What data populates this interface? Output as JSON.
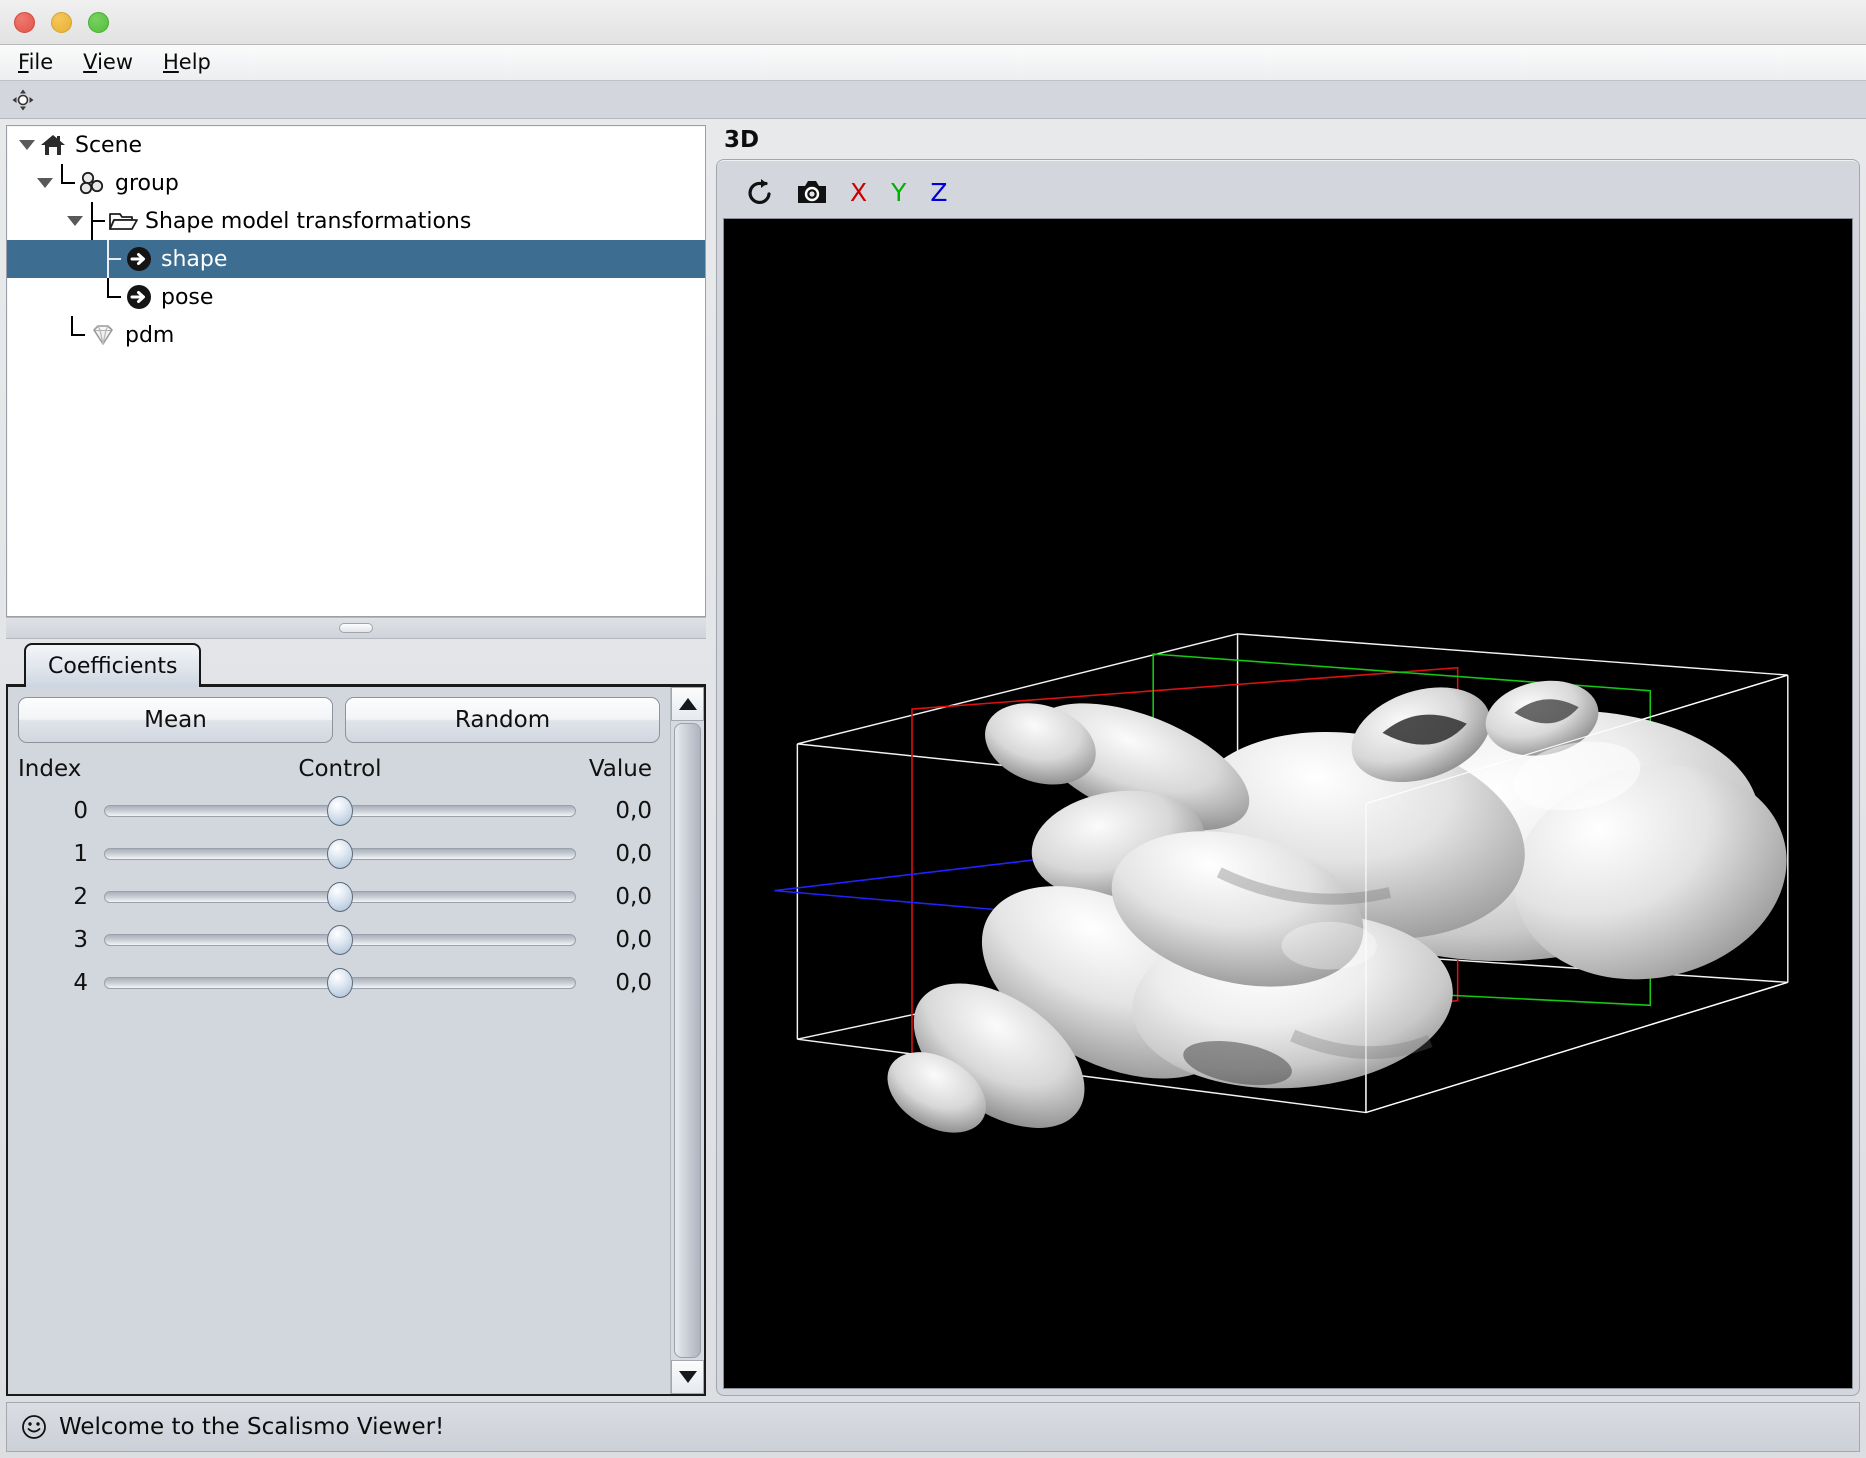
{
  "window": {
    "controls": [
      "close",
      "minimize",
      "maximize"
    ]
  },
  "menubar": {
    "items": [
      {
        "label": "File",
        "mnemonic": "F",
        "rest": "ile"
      },
      {
        "label": "View",
        "mnemonic": "V",
        "rest": "iew"
      },
      {
        "label": "Help",
        "mnemonic": "H",
        "rest": "elp"
      }
    ]
  },
  "toolbar": {
    "buttons": [
      {
        "name": "move-tool",
        "icon": "move-icon"
      }
    ]
  },
  "tree": {
    "nodes": [
      {
        "label": "Scene",
        "icon": "home-icon",
        "depth": 0,
        "expanded": true,
        "selected": false
      },
      {
        "label": "group",
        "icon": "group-icon",
        "depth": 1,
        "expanded": true,
        "selected": false
      },
      {
        "label": "Shape model transformations",
        "icon": "folder-open-icon",
        "depth": 2,
        "expanded": true,
        "selected": false
      },
      {
        "label": "shape",
        "icon": "arrow-circle-icon",
        "depth": 3,
        "expanded": false,
        "selected": true
      },
      {
        "label": "pose",
        "icon": "arrow-circle-icon",
        "depth": 3,
        "expanded": false,
        "selected": false
      },
      {
        "label": "pdm",
        "icon": "diamond-icon",
        "depth": 2,
        "expanded": false,
        "selected": false
      }
    ]
  },
  "coefficients": {
    "tab_label": "Coefficients",
    "mean_label": "Mean",
    "random_label": "Random",
    "headers": {
      "index": "Index",
      "control": "Control",
      "value": "Value"
    },
    "rows": [
      {
        "index": "0",
        "value": "0,0",
        "position": 50
      },
      {
        "index": "1",
        "value": "0,0",
        "position": 50
      },
      {
        "index": "2",
        "value": "0,0",
        "position": 50
      },
      {
        "index": "3",
        "value": "0,0",
        "position": 50
      },
      {
        "index": "4",
        "value": "0,0",
        "position": 50
      }
    ]
  },
  "viewer": {
    "title": "3D",
    "toolbar": {
      "reset_icon": "rotate-ccw-icon",
      "screenshot_icon": "camera-icon",
      "axes": [
        {
          "label": "X",
          "color": "#cc0000"
        },
        {
          "label": "Y",
          "color": "#00b000"
        },
        {
          "label": "Z",
          "color": "#0000d8"
        }
      ]
    },
    "scene": {
      "background": "#000000",
      "bounding_box_color": "#ffffff",
      "slice_planes": [
        {
          "axis": "X",
          "color": "#cc1111"
        },
        {
          "axis": "Y",
          "color": "#14b814"
        },
        {
          "axis": "Z",
          "color": "#1a1aff"
        }
      ],
      "mesh_label": "vertebra-surface-mesh"
    }
  },
  "statusbar": {
    "icon": "smiley-icon",
    "message": "Welcome to the Scalismo Viewer!"
  }
}
